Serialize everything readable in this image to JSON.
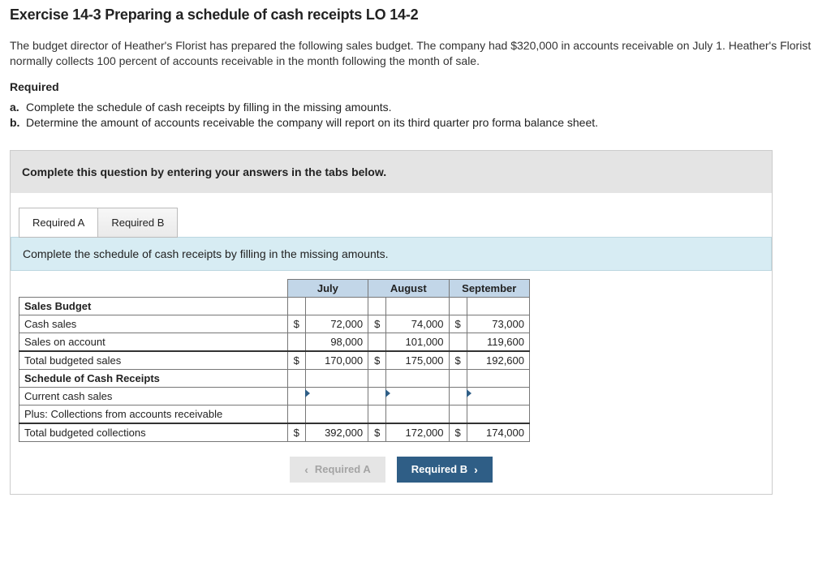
{
  "title": "Exercise 14-3 Preparing a schedule of cash receipts LO 14-2",
  "intro": "The budget director of Heather's Florist has prepared the following sales budget. The company had $320,000 in accounts receivable on July 1. Heather's Florist normally collects 100 percent of accounts receivable in the month following the month of sale.",
  "required_heading": "Required",
  "requirements": {
    "a_bullet": "a.",
    "a_text": "Complete the schedule of cash receipts by filling in the missing amounts.",
    "b_bullet": "b.",
    "b_text": "Determine the amount of accounts receivable the company will report on its third quarter pro forma balance sheet."
  },
  "answer_instruction": "Complete this question by entering your answers in the tabs below.",
  "tabs": {
    "a": "Required A",
    "b": "Required B"
  },
  "sub_instruction": "Complete the schedule of cash receipts by filling in the missing amounts.",
  "columns": {
    "july": "July",
    "august": "August",
    "september": "September"
  },
  "rows": {
    "sales_budget": "Sales Budget",
    "cash_sales": "Cash sales",
    "sales_on_account": "Sales on account",
    "total_budgeted_sales": "Total budgeted sales",
    "schedule_receipts": "Schedule of Cash Receipts",
    "current_cash_sales": "Current cash sales",
    "plus_collections": "Plus: Collections from accounts receivable",
    "total_collections": "Total budgeted collections"
  },
  "values": {
    "cash_sales": {
      "jul_sym": "$",
      "jul": "72,000",
      "aug_sym": "$",
      "aug": "74,000",
      "sep_sym": "$",
      "sep": "73,000"
    },
    "sales_on_account": {
      "jul_sym": "",
      "jul": "98,000",
      "aug_sym": "",
      "aug": "101,000",
      "sep_sym": "",
      "sep": "119,600"
    },
    "total_sales": {
      "jul_sym": "$",
      "jul": "170,000",
      "aug_sym": "$",
      "aug": "175,000",
      "sep_sym": "$",
      "sep": "192,600"
    },
    "current_cash": {
      "jul_sym": "",
      "jul": "",
      "aug_sym": "",
      "aug": "",
      "sep_sym": "",
      "sep": ""
    },
    "plus_collections": {
      "jul_sym": "",
      "jul": "",
      "aug_sym": "",
      "aug": "",
      "sep_sym": "",
      "sep": ""
    },
    "total_collections": {
      "jul_sym": "$",
      "jul": "392,000",
      "aug_sym": "$",
      "aug": "172,000",
      "sep_sym": "$",
      "sep": "174,000"
    }
  },
  "nav": {
    "prev": "Required A",
    "next": "Required B"
  }
}
